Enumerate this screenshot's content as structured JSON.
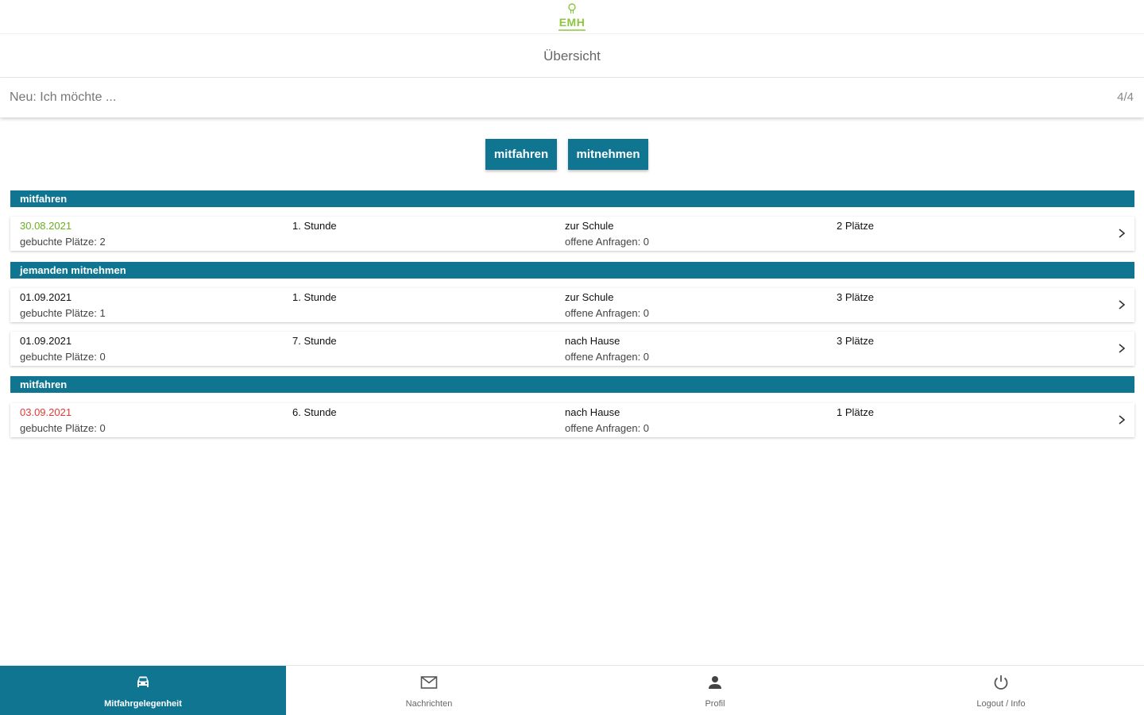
{
  "header": {
    "logo_text": "EMH",
    "title": "Übersicht"
  },
  "search": {
    "placeholder": "Neu: Ich möchte ...",
    "count": "4/4"
  },
  "actions": {
    "ride_label": "mitfahren",
    "take_label": "mitnehmen"
  },
  "sections": [
    {
      "title": "mitfahren",
      "rows": [
        {
          "date": "30.08.2021",
          "date_status": "green",
          "booked": "gebuchte Plätze: 2",
          "period": "1. Stunde",
          "direction": "zur Schule",
          "requests": "offene Anfragen: 0",
          "seats": "2 Plätze"
        }
      ]
    },
    {
      "title": "jemanden mitnehmen",
      "rows": [
        {
          "date": "01.09.2021",
          "date_status": "normal",
          "booked": "gebuchte Plätze: 1",
          "period": "1. Stunde",
          "direction": "zur Schule",
          "requests": "offene Anfragen: 0",
          "seats": "3 Plätze"
        },
        {
          "date": "01.09.2021",
          "date_status": "normal",
          "booked": "gebuchte Plätze: 0",
          "period": "7. Stunde",
          "direction": "nach Hause",
          "requests": "offene Anfragen: 0",
          "seats": "3 Plätze"
        }
      ]
    },
    {
      "title": "mitfahren",
      "rows": [
        {
          "date": "03.09.2021",
          "date_status": "red",
          "booked": "gebuchte Plätze: 0",
          "period": "6. Stunde",
          "direction": "nach Hause",
          "requests": "offene Anfragen: 0",
          "seats": "1 Plätze"
        }
      ]
    }
  ],
  "nav": {
    "items": [
      {
        "label": "Mitfahrgelegenheit",
        "icon": "car-icon",
        "active": true
      },
      {
        "label": "Nachrichten",
        "icon": "mail-icon",
        "active": false
      },
      {
        "label": "Profil",
        "icon": "person-icon",
        "active": false
      },
      {
        "label": "Logout / Info",
        "icon": "power-icon",
        "active": false
      }
    ]
  },
  "colors": {
    "primary": "#0f7591",
    "logo_green": "#8cc63f",
    "date_green": "#6ab023",
    "date_red": "#e53935"
  }
}
